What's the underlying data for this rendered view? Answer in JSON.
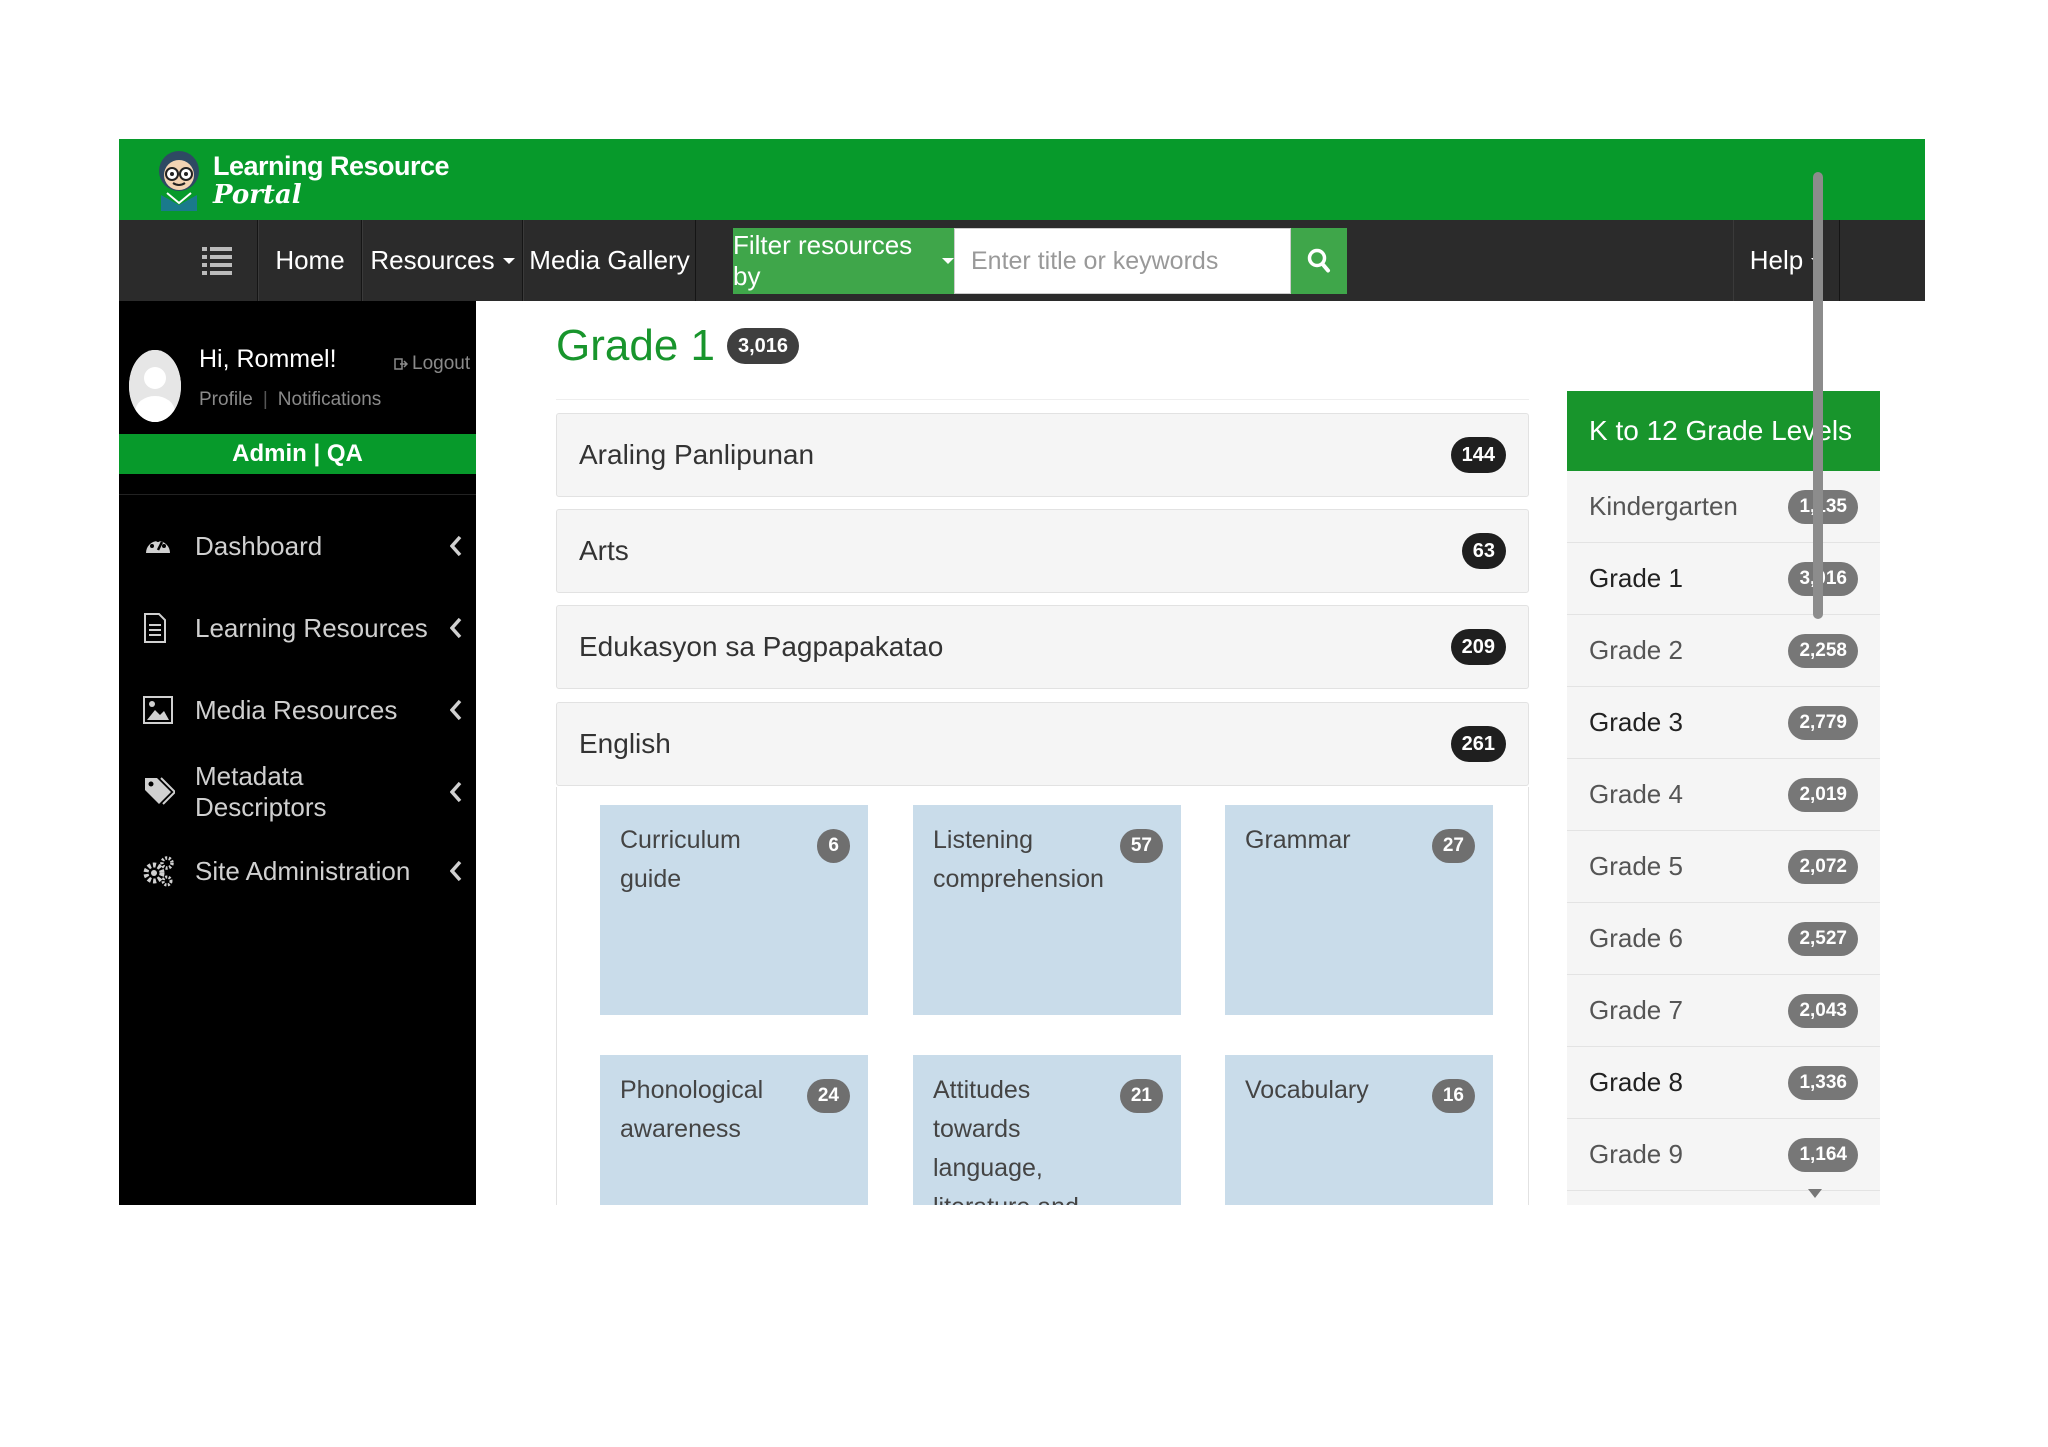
{
  "header": {
    "logo_line1": "Learning Resource",
    "logo_line2": "Portal"
  },
  "nav": {
    "home": "Home",
    "resources": "Resources",
    "media_gallery": "Media Gallery",
    "filter_label": "Filter resources by",
    "search_placeholder": "Enter title or keywords",
    "help": "Help"
  },
  "sidebar": {
    "greeting": "Hi, Rommel!",
    "logout": "Logout",
    "profile": "Profile",
    "notifications": "Notifications",
    "role": "Admin | QA",
    "items": [
      {
        "label": "Dashboard",
        "icon": "dashboard-icon"
      },
      {
        "label": "Learning Resources",
        "icon": "document-icon"
      },
      {
        "label": "Media Resources",
        "icon": "image-icon"
      },
      {
        "label": "Metadata Descriptors",
        "icon": "tags-icon"
      },
      {
        "label": "Site Administration",
        "icon": "gears-icon"
      }
    ]
  },
  "main": {
    "title": "Grade 1",
    "title_count": "3,016",
    "subjects": [
      {
        "label": "Araling Panlipunan",
        "count": "144"
      },
      {
        "label": "Arts",
        "count": "63"
      },
      {
        "label": "Edukasyon sa Pagpapakatao",
        "count": "209"
      },
      {
        "label": "English",
        "count": "261"
      }
    ],
    "english_topics": [
      {
        "label": "Curriculum guide",
        "count": "6"
      },
      {
        "label": "Listening comprehension",
        "count": "57"
      },
      {
        "label": "Grammar",
        "count": "27"
      },
      {
        "label": "Phonological awareness",
        "count": "24"
      },
      {
        "label": "Attitudes towards language, literature and literacy",
        "count": "21"
      },
      {
        "label": "Vocabulary",
        "count": "16"
      }
    ]
  },
  "levels": {
    "title": "K to 12 Grade Levels",
    "items": [
      {
        "label": "Kindergarten",
        "count": "1,135"
      },
      {
        "label": "Grade 1",
        "count": "3,016"
      },
      {
        "label": "Grade 2",
        "count": "2,258"
      },
      {
        "label": "Grade 3",
        "count": "2,779"
      },
      {
        "label": "Grade 4",
        "count": "2,019"
      },
      {
        "label": "Grade 5",
        "count": "2,072"
      },
      {
        "label": "Grade 6",
        "count": "2,527"
      },
      {
        "label": "Grade 7",
        "count": "2,043"
      },
      {
        "label": "Grade 8",
        "count": "1,336"
      },
      {
        "label": "Grade 9",
        "count": "1,164"
      }
    ]
  },
  "colors": {
    "brand_green": "#079a2b",
    "title_green": "#18952c",
    "button_green": "#3fa64a",
    "nav_dark": "#2b2b2b",
    "tile_blue": "#c9dcea"
  }
}
